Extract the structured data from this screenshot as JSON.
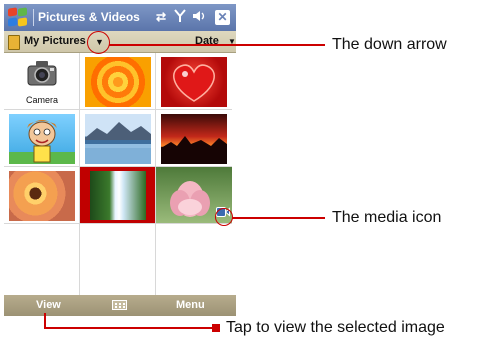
{
  "title_bar": {
    "app_title": "Pictures & Videos",
    "connectivity_icon": "connectivity-arrows-icon",
    "signal_icon": "signal-strength-icon",
    "volume_icon": "speaker-icon",
    "close_label": "✕"
  },
  "folder_bar": {
    "folder_name": "My Pictures",
    "sort_label": "Date"
  },
  "grid": {
    "camera_label": "Camera",
    "thumbnails": [
      "camera",
      "orange-rings",
      "red-heart",
      "cartoon-character",
      "mountain-lake",
      "red-sunset",
      "flower-closeup",
      "waterfall",
      "lotus-flower"
    ]
  },
  "soft_keys": {
    "left": "View",
    "right": "Menu",
    "center_icon": "keyboard-icon"
  },
  "annotations": {
    "down_arrow": "The down arrow",
    "media_icon": "The media icon",
    "tap_view": "Tap to view the selected image"
  },
  "colors": {
    "annotation": "#cc0000",
    "title_bar": "#6a82b6",
    "soft_key_bar": "#a89e80"
  }
}
